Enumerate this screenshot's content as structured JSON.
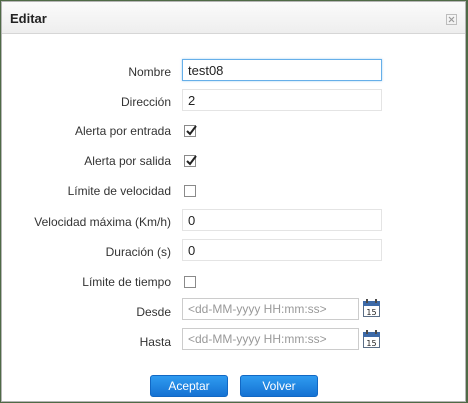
{
  "dialog": {
    "title": "Editar",
    "close_icon": "close-icon"
  },
  "form": {
    "nombre": {
      "label": "Nombre",
      "value": "test08"
    },
    "direccion": {
      "label": "Dirección",
      "value": "2"
    },
    "alerta_entrada": {
      "label": "Alerta por entrada",
      "checked": true
    },
    "alerta_salida": {
      "label": "Alerta por salida",
      "checked": true
    },
    "limite_velocidad": {
      "label": "Límite de velocidad",
      "checked": false
    },
    "velocidad_maxima": {
      "label": "Velocidad máxima (Km/h)",
      "value": "0"
    },
    "duracion": {
      "label": "Duración (s)",
      "value": "0"
    },
    "limite_tiempo": {
      "label": "Límite de tiempo",
      "checked": false
    },
    "desde": {
      "label": "Desde",
      "placeholder": "<dd-MM-yyyy HH:mm:ss>",
      "calendar_day": "15"
    },
    "hasta": {
      "label": "Hasta",
      "placeholder": "<dd-MM-yyyy HH:mm:ss>",
      "calendar_day": "15"
    }
  },
  "buttons": {
    "accept": "Aceptar",
    "back": "Volver"
  },
  "colors": {
    "button": "#1f86e6",
    "focus_border": "#66afe9"
  }
}
